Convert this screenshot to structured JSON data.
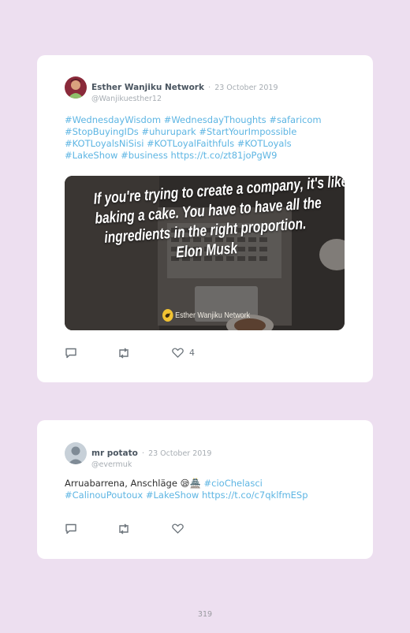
{
  "tweets": [
    {
      "author": "Esther Wanjiku Network",
      "separator": "·",
      "date": "23 October 2019",
      "handle": "@Wanjikuesther12",
      "lines": [
        [
          {
            "text": "#WednesdayWisdom",
            "tag": true
          },
          {
            "text": " ",
            "tag": false
          },
          {
            "text": "#WednesdayThoughts",
            "tag": true
          },
          {
            "text": " ",
            "tag": false
          },
          {
            "text": "#safaricom",
            "tag": true
          }
        ],
        [
          {
            "text": "#StopBuyingIDs",
            "tag": true
          },
          {
            "text": " ",
            "tag": false
          },
          {
            "text": "#uhurupark",
            "tag": true
          },
          {
            "text": " ",
            "tag": false
          },
          {
            "text": "#StartYourImpossible",
            "tag": true
          }
        ],
        [
          {
            "text": "#KOTLoyalsNiSisi",
            "tag": true
          },
          {
            "text": " ",
            "tag": false
          },
          {
            "text": "#KOTLoyalFaithfuls",
            "tag": true
          },
          {
            "text": " ",
            "tag": false
          },
          {
            "text": "#KOTLoyals",
            "tag": true
          }
        ],
        [
          {
            "text": "#LakeShow",
            "tag": true
          },
          {
            "text": " ",
            "tag": false
          },
          {
            "text": "#business",
            "tag": true
          },
          {
            "text": " ",
            "tag": false
          },
          {
            "text": "https://t.co/zt81joPgW9",
            "tag": true
          }
        ]
      ],
      "image": {
        "quote_lines": [
          "If you're trying to create a company, it's like",
          "baking a cake. You have to have all the",
          "ingredients in the right proportion.",
          "Elon Musk"
        ],
        "credit": "Esther Wanjiku Network"
      },
      "likes": "4"
    },
    {
      "author": "mr potato",
      "separator": "·",
      "date": "23 October 2019",
      "handle": "@evermuk",
      "lines": [
        [
          {
            "text": "Arruabarrena, Anschläge 😪🏯 ",
            "tag": false
          },
          {
            "text": "#cioChelasci",
            "tag": true
          }
        ],
        [
          {
            "text": "#CalinouPoutoux",
            "tag": true
          },
          {
            "text": " ",
            "tag": false
          },
          {
            "text": "#LakeShow",
            "tag": true
          },
          {
            "text": " ",
            "tag": false
          },
          {
            "text": "https://t.co/c7qklfmESp",
            "tag": true
          }
        ]
      ],
      "likes": ""
    }
  ],
  "page_number": "319",
  "colors": {
    "background": "#eddff0",
    "link": "#5db5e3",
    "muted": "#a7adb3"
  },
  "icons": [
    "reply-icon",
    "retweet-icon",
    "like-icon",
    "twitter-bird-icon"
  ]
}
